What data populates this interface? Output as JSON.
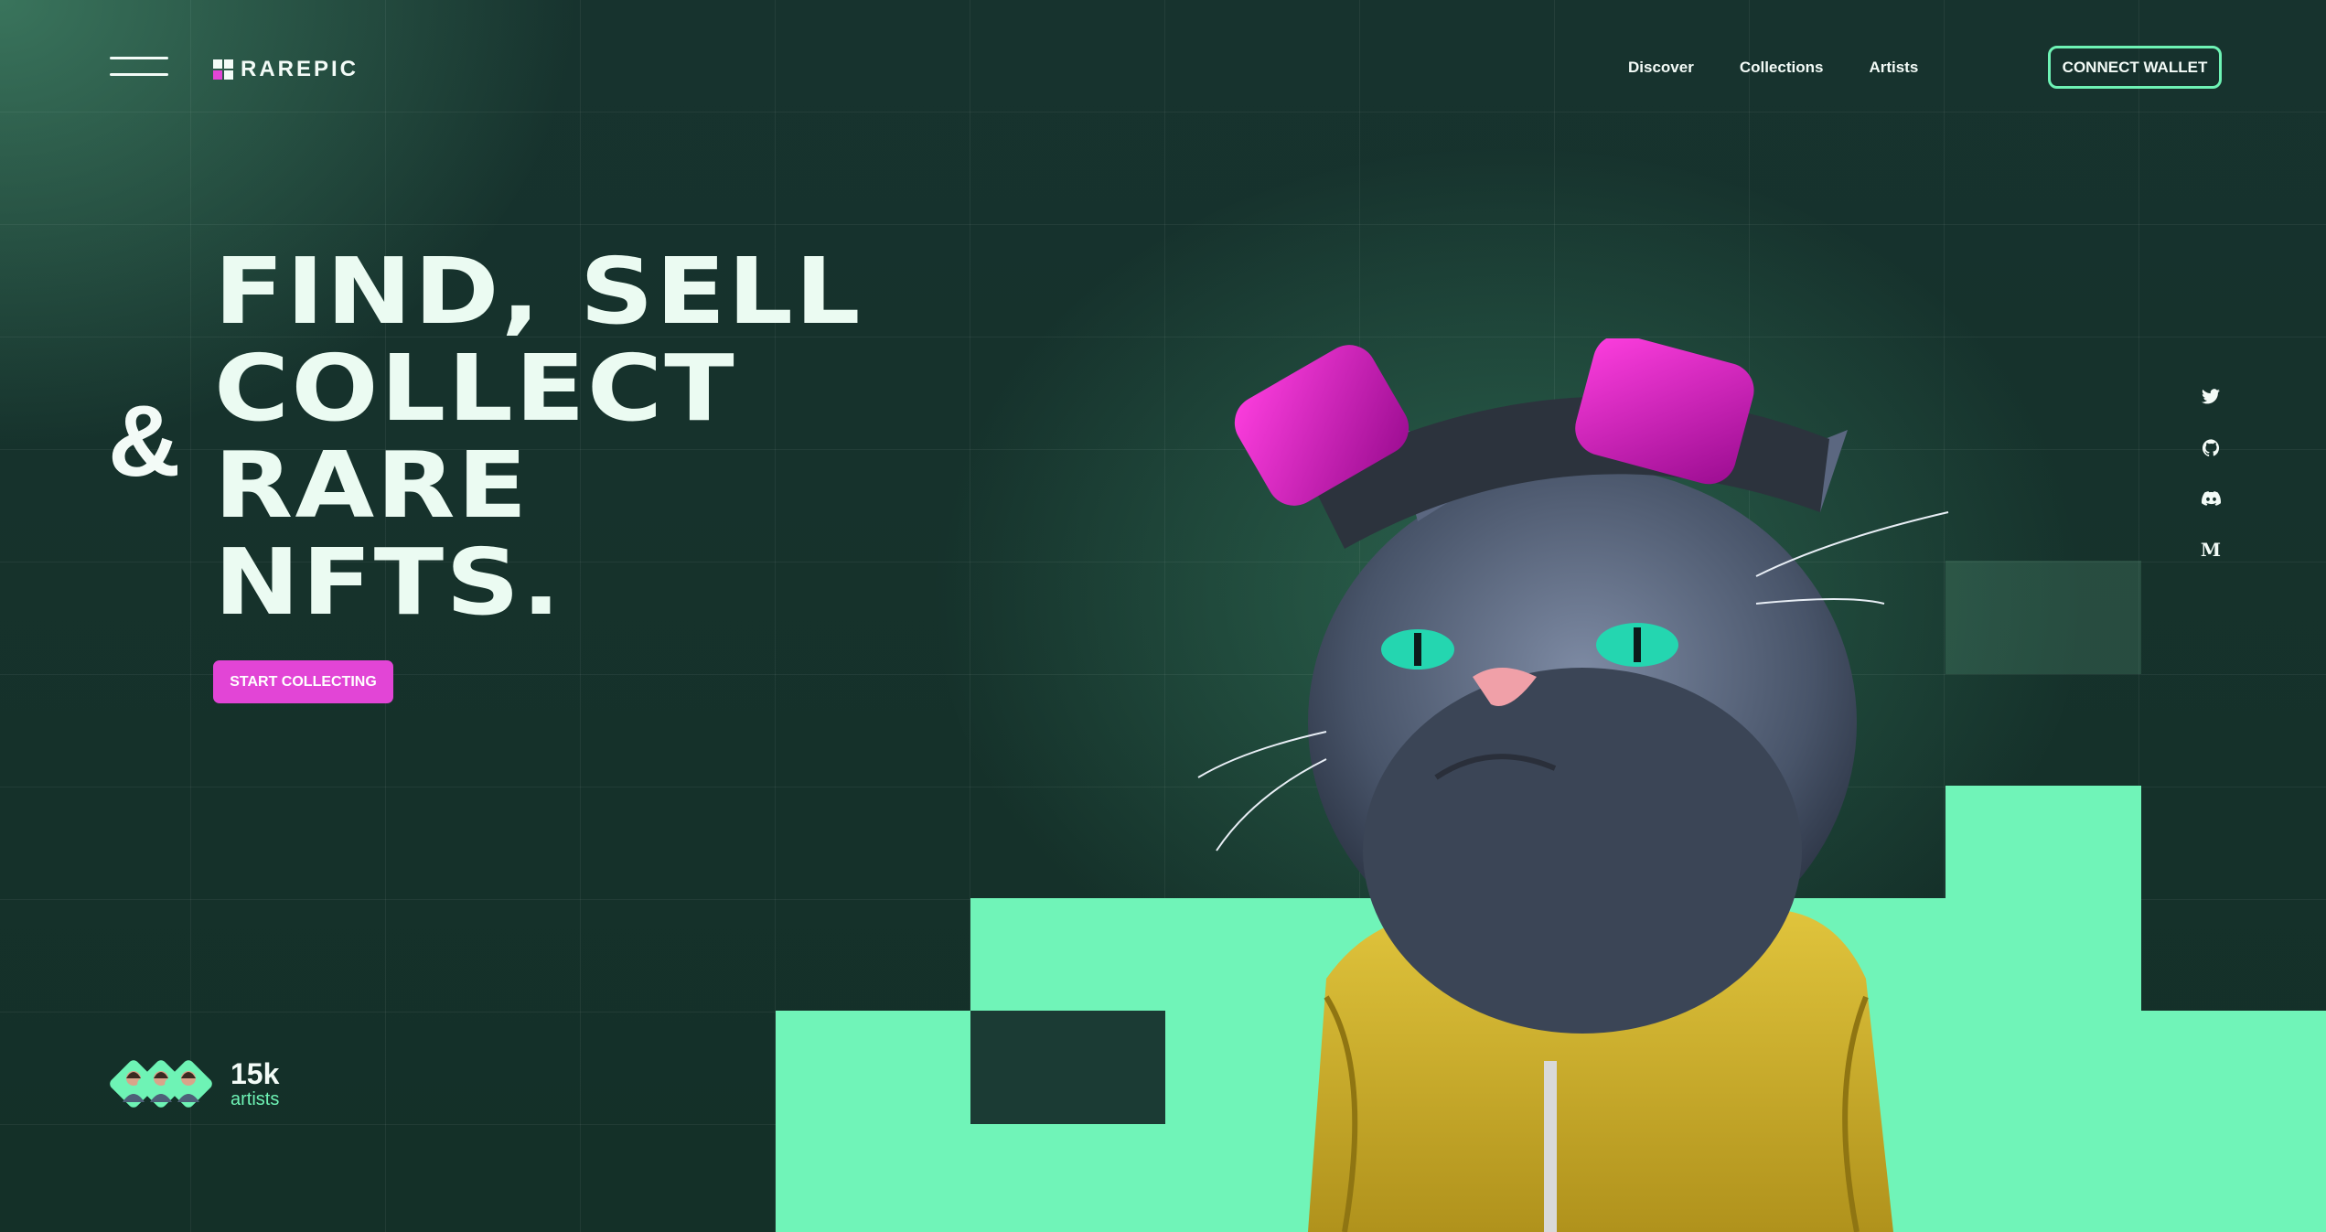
{
  "header": {
    "logo_text": "RAREPIC",
    "nav": [
      "Discover",
      "Collections",
      "Artists"
    ],
    "connect_label": "CONNECT WALLET"
  },
  "hero": {
    "ampersand": "&",
    "headline": [
      "FIND, SELL",
      "COLLECT",
      "RARE",
      "NFTS."
    ],
    "cta_label": "START COLLECTING"
  },
  "artists": {
    "count": "15k",
    "label": "artists"
  },
  "social": [
    "twitter-icon",
    "github-icon",
    "discord-icon",
    "medium-icon"
  ],
  "colors": {
    "background": "#14302b",
    "accent_mint": "#70f4b8",
    "accent_pink": "#e245d6",
    "text": "#f3fbf7"
  }
}
